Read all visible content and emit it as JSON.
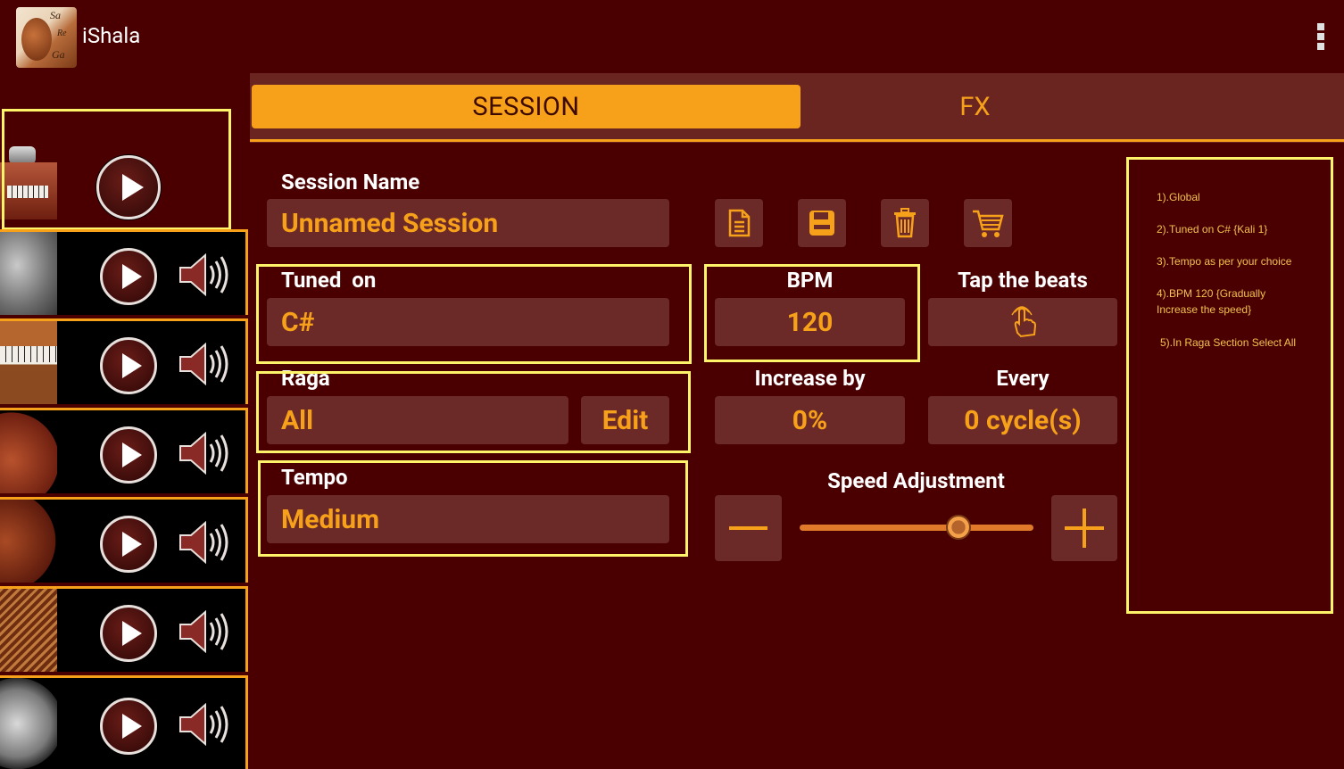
{
  "app": {
    "title": "iShala",
    "logo_text": [
      "Sa",
      "Re",
      "Ga"
    ]
  },
  "tabs": [
    {
      "label": "SESSION",
      "active": true
    },
    {
      "label": "FX",
      "active": false
    }
  ],
  "session": {
    "name_label": "Session Name",
    "name_value": "Unnamed Session",
    "tuned_label": "Tuned  on",
    "tuned_value": "C#",
    "bpm_label": "BPM",
    "bpm_value": "120",
    "tap_label": "Tap the beats",
    "raga_label": "Raga",
    "raga_value": "All",
    "edit_label": "Edit",
    "increase_label": "Increase by",
    "increase_value": "0%",
    "every_label": "Every",
    "every_value": "0 cycle(s)",
    "tempo_label": "Tempo",
    "tempo_value": "Medium",
    "speed_label": "Speed Adjustment",
    "speed_level": 0.68
  },
  "toolbar_icons": [
    "document-icon",
    "save-icon",
    "trash-icon",
    "cart-icon"
  ],
  "instruments": [
    "harmonium-tabla",
    "tabla",
    "harmonium",
    "tanpura",
    "tanpura-2",
    "swarmandal",
    "manjira"
  ],
  "notes": [
    "1).Global",
    "2).Tuned on C# {Kali 1}",
    "3).Tempo as per your choice",
    "4).BPM 120 {Gradually Increase the speed}",
    "5).In Raga Section Select All"
  ],
  "colors": {
    "background": "#4a0000",
    "accent": "#f7a11a",
    "field": "#6b2a28",
    "highlight": "#fff36a"
  }
}
